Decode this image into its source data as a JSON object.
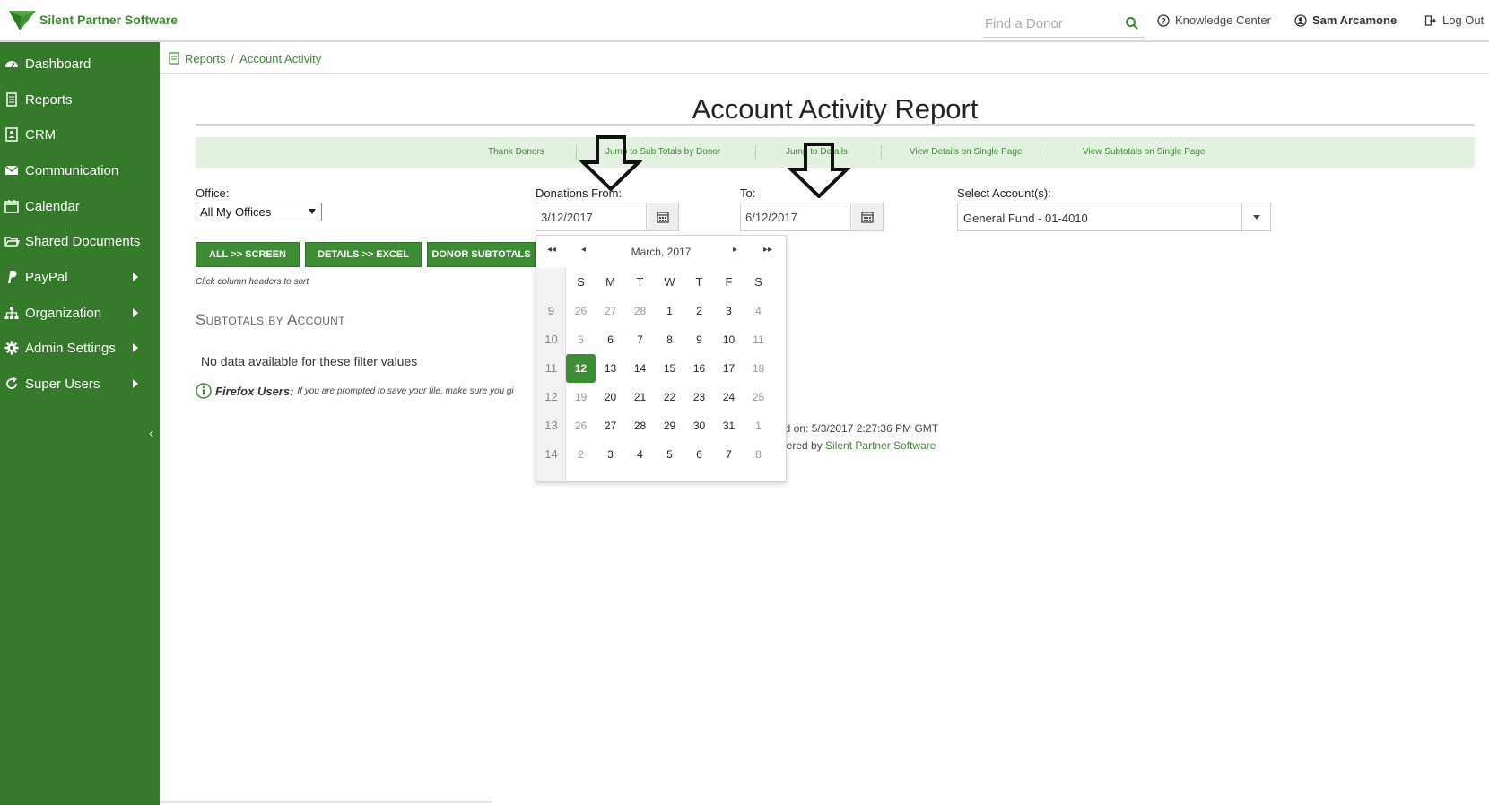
{
  "brand": {
    "name": "Silent Partner Software"
  },
  "topbar": {
    "search_placeholder": "Find a Donor",
    "knowledge_center": "Knowledge Center",
    "user_name": "Sam Arcamone",
    "logout": "Log Out"
  },
  "sidebar": {
    "items": [
      {
        "label": "Dashboard",
        "icon": "dashboard-icon"
      },
      {
        "label": "Reports",
        "icon": "document-icon"
      },
      {
        "label": "CRM",
        "icon": "contact-card-icon"
      },
      {
        "label": "Communication",
        "icon": "envelope-icon"
      },
      {
        "label": "Calendar",
        "icon": "calendar-icon"
      },
      {
        "label": "Shared Documents",
        "icon": "folder-open-icon"
      },
      {
        "label": "PayPal",
        "icon": "paypal-icon"
      },
      {
        "label": "Organization",
        "icon": "sitemap-icon"
      },
      {
        "label": "Admin Settings",
        "icon": "gear-icon"
      },
      {
        "label": "Super Users",
        "icon": "refresh-icon"
      }
    ],
    "collapse_icon": "chevron-left-icon"
  },
  "breadcrumb": {
    "reports": "Reports",
    "separator": "/",
    "current": "Account Activity"
  },
  "page": {
    "title": "Account Activity Report"
  },
  "linkbar": {
    "links": [
      "Thank Donors",
      "Jump to Sub Totals by Donor",
      "Jump to Details",
      "View Details on Single Page",
      "View Subtotals on Single Page"
    ]
  },
  "filters": {
    "office_label": "Office:",
    "office_value": "All My Offices",
    "from_label": "Donations From:",
    "from_value": "3/12/2017",
    "to_label": "To:",
    "to_value": "6/12/2017",
    "account_label": "Select Account(s):",
    "account_value": "General Fund - 01-4010"
  },
  "buttons": {
    "all_screen": "ALL >> SCREEN",
    "details_excel": "DETAILS >> EXCEL",
    "donor_subtotals": "DONOR SUBTOTALS"
  },
  "hint": "Click column headers to sort",
  "section_title": "Subtotals by Account",
  "no_data": "No data available for these filter values",
  "firefox": {
    "label": "Firefox Users:",
    "text": "If you are prompted to save your file, make sure you gi"
  },
  "footer": {
    "generated": "ed on: 5/3/2017 2:27:36 PM GMT",
    "powered_prefix": "wered by",
    "powered_link": "Silent Partner Software"
  },
  "datepicker": {
    "month_label": "March, 2017",
    "nav": {
      "prev_year": "◂◂",
      "prev_month": "◂",
      "next_month": "▸",
      "next_year": "▸▸"
    },
    "dow": [
      "S",
      "M",
      "T",
      "W",
      "T",
      "F",
      "S"
    ],
    "weeks": [
      {
        "wk": "9",
        "days": [
          "26",
          "27",
          "28",
          "1",
          "2",
          "3",
          "4"
        ]
      },
      {
        "wk": "10",
        "days": [
          "5",
          "6",
          "7",
          "8",
          "9",
          "10",
          "11"
        ]
      },
      {
        "wk": "11",
        "days": [
          "12",
          "13",
          "14",
          "15",
          "16",
          "17",
          "18"
        ]
      },
      {
        "wk": "12",
        "days": [
          "19",
          "20",
          "21",
          "22",
          "23",
          "24",
          "25"
        ]
      },
      {
        "wk": "13",
        "days": [
          "26",
          "27",
          "28",
          "29",
          "30",
          "31",
          "1"
        ]
      },
      {
        "wk": "14",
        "days": [
          "2",
          "3",
          "4",
          "5",
          "6",
          "7",
          "8"
        ]
      }
    ],
    "selected_day": "12"
  },
  "colors": {
    "brand_green": "#357a2b",
    "accent_green": "#3c8d33",
    "link_green": "#3a8a2e",
    "linkbar_bg": "#e3f1e1"
  }
}
